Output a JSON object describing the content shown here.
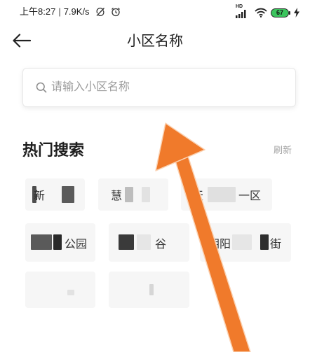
{
  "status_bar": {
    "time": "上午8:27",
    "separator": "|",
    "net_speed": "7.9K/s",
    "network_label": "HD",
    "battery_level": "67"
  },
  "header": {
    "title": "小区名称"
  },
  "search": {
    "placeholder": "请输入小区名称"
  },
  "hot_search": {
    "title": "热门搜索",
    "refresh_label": "刷新",
    "chips": [
      {
        "segments": [
          "新"
        ]
      },
      {
        "segments": [
          "慧"
        ]
      },
      {
        "segments": [
          "天",
          "一区"
        ]
      },
      {
        "segments": [
          "公园"
        ]
      },
      {
        "segments": [
          "谷"
        ]
      },
      {
        "segments": [
          "朝阳",
          "街"
        ]
      },
      {
        "segments": []
      },
      {
        "segments": []
      }
    ]
  },
  "colors": {
    "text_primary": "#222222",
    "text_secondary": "#a3a3a3",
    "chip_background": "#f6f6f6",
    "battery_green": "#3bc45d",
    "annotation_arrow": "#f07a2b"
  },
  "icons": {
    "status_left": [
      "sync-off-icon",
      "alarm-clock-icon"
    ],
    "status_right": [
      "cellular-signal-icon",
      "wifi-icon",
      "battery-icon",
      "charging-bolt-icon"
    ],
    "header": "back-arrow-icon",
    "search": "search-icon",
    "annotation": "arrow-pointer"
  }
}
